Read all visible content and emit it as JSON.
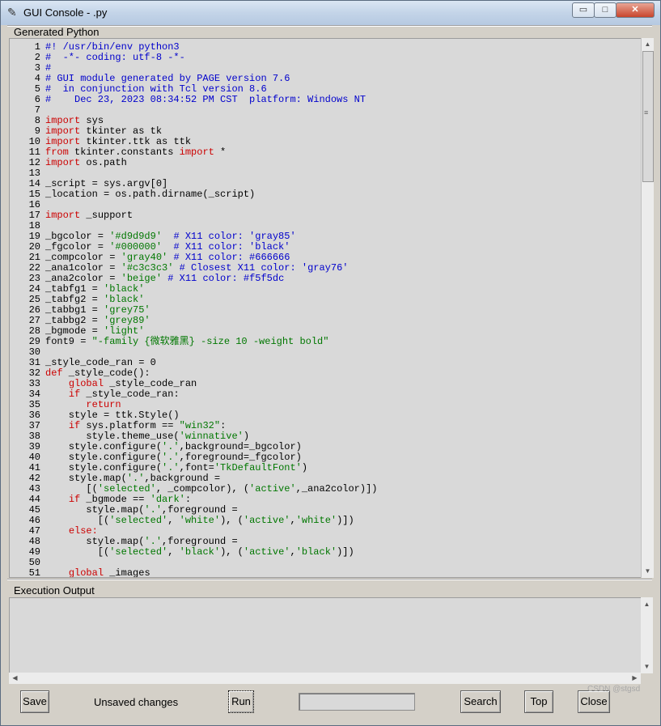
{
  "window": {
    "title": "GUI Console - .py",
    "title_icon": "feather-icon",
    "min_glyph": "▭",
    "max_glyph": "□",
    "close_glyph": "✕"
  },
  "generated_section": {
    "label": "Generated Python"
  },
  "execution_section": {
    "label": "Execution Output"
  },
  "code_lines": [
    {
      "n": "1",
      "t": "#! /usr/bin/env python3"
    },
    {
      "n": "2",
      "t": "#  -*- coding: utf-8 -*-"
    },
    {
      "n": "3",
      "t": "#"
    },
    {
      "n": "4",
      "t": "# GUI module generated by PAGE version 7.6"
    },
    {
      "n": "5",
      "t": "#  in conjunction with Tcl version 8.6"
    },
    {
      "n": "6",
      "t": "#    Dec 23, 2023 08:34:52 PM CST  platform: Windows NT"
    },
    {
      "n": "7",
      "t": ""
    },
    {
      "n": "8",
      "t": "import sys"
    },
    {
      "n": "9",
      "t": "import tkinter as tk"
    },
    {
      "n": "10",
      "t": "import tkinter.ttk as ttk"
    },
    {
      "n": "11",
      "t": "from tkinter.constants import *"
    },
    {
      "n": "12",
      "t": "import os.path"
    },
    {
      "n": "13",
      "t": ""
    },
    {
      "n": "14",
      "t": "_script = sys.argv[0]"
    },
    {
      "n": "15",
      "t": "_location = os.path.dirname(_script)"
    },
    {
      "n": "16",
      "t": ""
    },
    {
      "n": "17",
      "t": "import _support"
    },
    {
      "n": "18",
      "t": ""
    },
    {
      "n": "19",
      "t": "_bgcolor = '#d9d9d9'  # X11 color: 'gray85'"
    },
    {
      "n": "20",
      "t": "_fgcolor = '#000000'  # X11 color: 'black'"
    },
    {
      "n": "21",
      "t": "_compcolor = 'gray40' # X11 color: #666666"
    },
    {
      "n": "22",
      "t": "_ana1color = '#c3c3c3' # Closest X11 color: 'gray76'"
    },
    {
      "n": "23",
      "t": "_ana2color = 'beige' # X11 color: #f5f5dc"
    },
    {
      "n": "24",
      "t": "_tabfg1 = 'black'"
    },
    {
      "n": "25",
      "t": "_tabfg2 = 'black'"
    },
    {
      "n": "26",
      "t": "_tabbg1 = 'grey75'"
    },
    {
      "n": "27",
      "t": "_tabbg2 = 'grey89'"
    },
    {
      "n": "28",
      "t": "_bgmode = 'light'"
    },
    {
      "n": "29",
      "t": "font9 = \"-family {微软雅黑} -size 10 -weight bold\""
    },
    {
      "n": "30",
      "t": ""
    },
    {
      "n": "31",
      "t": "_style_code_ran = 0"
    },
    {
      "n": "32",
      "t": "def _style_code():"
    },
    {
      "n": "33",
      "t": "    global _style_code_ran"
    },
    {
      "n": "34",
      "t": "    if _style_code_ran:"
    },
    {
      "n": "35",
      "t": "       return"
    },
    {
      "n": "36",
      "t": "    style = ttk.Style()"
    },
    {
      "n": "37",
      "t": "    if sys.platform == \"win32\":"
    },
    {
      "n": "38",
      "t": "       style.theme_use('winnative')"
    },
    {
      "n": "39",
      "t": "    style.configure('.',background=_bgcolor)"
    },
    {
      "n": "40",
      "t": "    style.configure('.',foreground=_fgcolor)"
    },
    {
      "n": "41",
      "t": "    style.configure('.',font='TkDefaultFont')"
    },
    {
      "n": "42",
      "t": "    style.map('.',background ="
    },
    {
      "n": "43",
      "t": "       [('selected', _compcolor), ('active',_ana2color)])"
    },
    {
      "n": "44",
      "t": "    if _bgmode == 'dark':"
    },
    {
      "n": "45",
      "t": "       style.map('.',foreground ="
    },
    {
      "n": "46",
      "t": "         [('selected', 'white'), ('active','white')])"
    },
    {
      "n": "47",
      "t": "    else:"
    },
    {
      "n": "48",
      "t": "       style.map('.',foreground ="
    },
    {
      "n": "49",
      "t": "         [('selected', 'black'), ('active','black')])"
    },
    {
      "n": "50",
      "t": ""
    },
    {
      "n": "51",
      "t": "    global _images"
    }
  ],
  "colors": {
    "comment": "#0000cc",
    "keyword": "#cc0000",
    "string": "#007700",
    "text": "#000000",
    "code_bg": "#d9d9d9"
  },
  "buttons": {
    "save": "Save",
    "run": "Run",
    "search": "Search",
    "top": "Top",
    "close": "Close"
  },
  "status": {
    "unsaved": "Unsaved changes"
  },
  "search": {
    "value": ""
  },
  "watermark": "CSDN @stgsd",
  "scroll_glyphs": {
    "up": "▲",
    "down": "▼",
    "left": "◀",
    "right": "▶",
    "grip": "≡"
  }
}
